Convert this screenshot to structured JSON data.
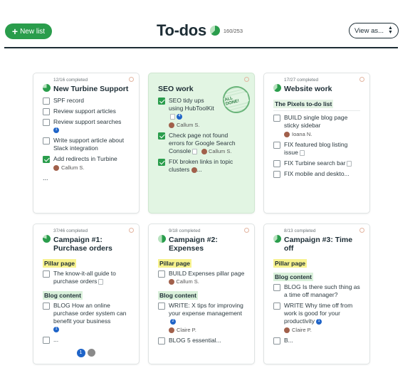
{
  "header": {
    "new_list_label": "New list",
    "title": "To-dos",
    "count": "160/253",
    "progress": 0.63,
    "view_label": "View as..."
  },
  "colors": {
    "accent": "#2a9d4c",
    "badge": "#1f64c8",
    "done_card": "#e2f5e3",
    "pillar": "#f7f28d",
    "blog": "#d9f0da"
  },
  "cards": [
    {
      "completed": "12/16 completed",
      "title": "New Turbine Support",
      "progress": 0.75,
      "tasks": [
        {
          "label": "SPF record",
          "checked": false
        },
        {
          "label": "Review support articles",
          "checked": false
        },
        {
          "label": "Review support searches",
          "checked": false,
          "badge": "1"
        },
        {
          "label": "Write support article about Slack integration",
          "checked": false
        },
        {
          "label": "Add redirects in Turbine",
          "checked": true,
          "assignee": "Callum S."
        },
        {
          "label": "...",
          "checked": false
        }
      ]
    },
    {
      "completed": "",
      "title": "SEO work",
      "progress": 1,
      "stamp": "ALL DONE!",
      "tasks": [
        {
          "label": "SEO tidy ups using HubToolKit",
          "checked": true,
          "badge": "4",
          "assignee": "Callum S."
        },
        {
          "label": "Check page not found errors for Google Search Console",
          "checked": true,
          "assignee": "Callum S."
        },
        {
          "label": "FIX broken links in topic clusters",
          "checked": true
        }
      ]
    },
    {
      "completed": "17/27 completed",
      "title": "Website work",
      "progress": 0.63,
      "section": "The Pixels to-do list",
      "tasks": [
        {
          "label": "BUILD single blog page sticky sidebar",
          "checked": false,
          "assignee": "Ioana N."
        },
        {
          "label": "FIX featured blog listing issue",
          "checked": false
        },
        {
          "label": "FIX Turbine search bar",
          "checked": false
        },
        {
          "label": "FIX mobile and deskto...",
          "checked": false
        }
      ]
    },
    {
      "completed": "37/46 completed",
      "title": "Campaign #1: Purchase orders",
      "progress": 0.8,
      "pillar_label": "Pillar page",
      "pillar_tasks": [
        {
          "label": "The know-it-all guide to purchase orders",
          "checked": false
        }
      ],
      "blog_label": "Blog content",
      "blog_tasks": [
        {
          "label": "BLOG How an online purchase order system can benefit your business",
          "checked": false,
          "badge": "1"
        },
        {
          "label": "...",
          "checked": false
        }
      ],
      "footer_badge": "1"
    },
    {
      "completed": "9/18 completed",
      "title": "Campaign #2: Expenses",
      "progress": 0.5,
      "pillar_label": "Pillar page",
      "pillar_tasks": [
        {
          "label": "BUILD Expenses pillar page",
          "checked": false,
          "assignee": "Callum S."
        }
      ],
      "blog_label": "Blog content",
      "blog_tasks": [
        {
          "label": "WRITE: X tips for improving your expense management",
          "checked": false,
          "badge": "2",
          "assignee": "Claire P."
        },
        {
          "label": "BLOG 5 essential...",
          "checked": false
        }
      ]
    },
    {
      "completed": "8/13 completed",
      "title": "Campaign #3: Time off",
      "progress": 0.62,
      "pillar_label": "Pillar page",
      "blog_label": "Blog content",
      "blog_tasks": [
        {
          "label": "BLOG Is there such thing as a time off manager?",
          "checked": false
        },
        {
          "label": "WRITE Why time off from work is good for your productivity",
          "checked": false,
          "badge": "1",
          "assignee": "Claire P."
        },
        {
          "label": "B...",
          "checked": false
        }
      ]
    }
  ]
}
